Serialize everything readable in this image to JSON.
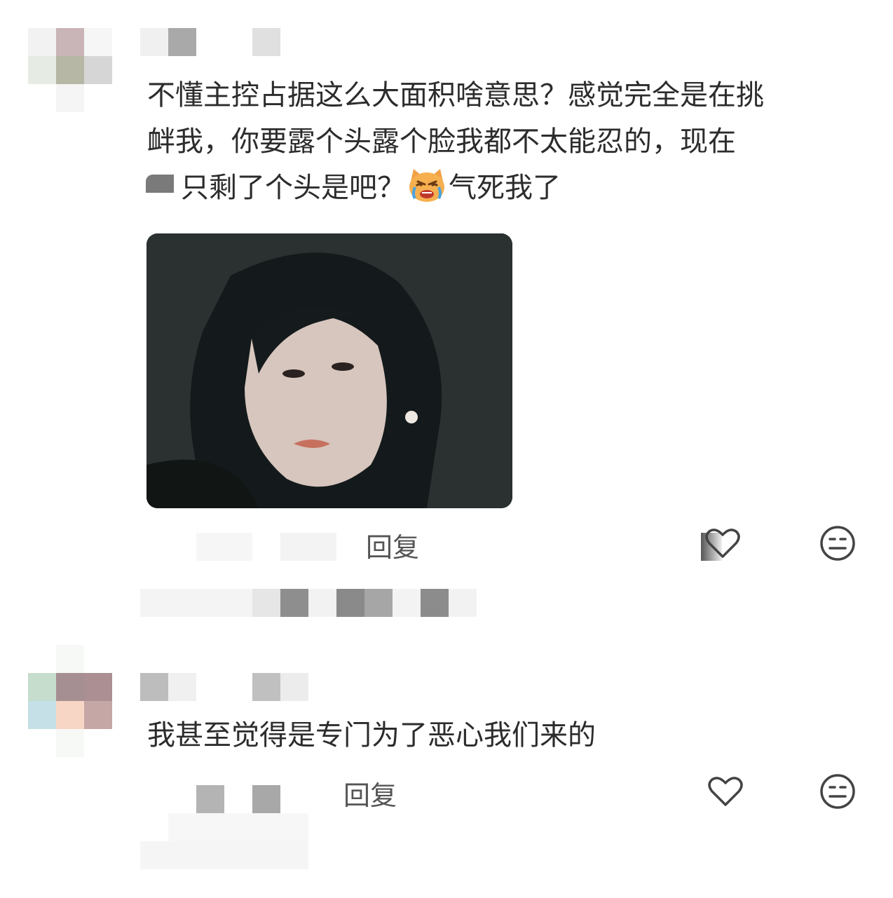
{
  "comments": [
    {
      "text_lines": [
        "不懂主控占据这么大面积啥意思？感觉完全是在挑",
        "衅我，你要露个头露个脸我都不太能忍的，现在",
        "只剩了个头是吧？"
      ],
      "text_tail": "气死我了",
      "inline_emoji": "crying-angry-cat-emoji",
      "reply_label": "回复"
    },
    {
      "text_lines": [
        "我甚至觉得是专门为了恶心我们来的"
      ],
      "reply_label": "回复"
    }
  ],
  "icons": {
    "like": "heart-icon",
    "dislike": "neutral-face-icon"
  },
  "colors": {
    "text": "#2c2c2c",
    "meta": "#555555",
    "icon": "#444444"
  }
}
